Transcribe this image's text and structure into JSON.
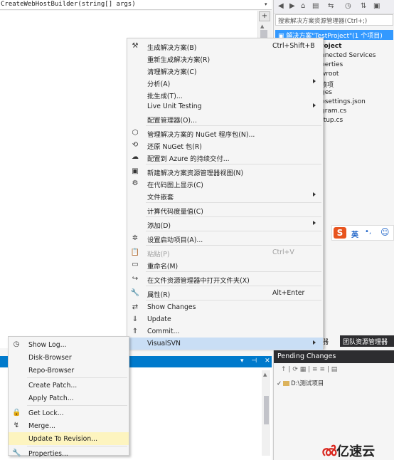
{
  "editor": {
    "signature": "CreateWebHostBuilder(string[] args)"
  },
  "solution_explorer": {
    "search_placeholder": "搜索解决方案资源管理器(Ctrl+;)",
    "solution_label": "解决方案\"TestProject\"(1 个项目)",
    "items": [
      {
        "label": "roject",
        "bold": true
      },
      {
        "label": "nnected Services",
        "bold": false
      },
      {
        "label": "perties",
        "bold": false
      },
      {
        "label": "wroot",
        "bold": false
      },
      {
        "label": "赖项",
        "bold": false
      },
      {
        "label": "ges",
        "bold": false
      },
      {
        "label": "psettings.json",
        "bold": false
      },
      {
        "label": "gram.cs",
        "bold": false
      },
      {
        "label": "rtup.cs",
        "bold": false
      }
    ],
    "tab_partial": "理器",
    "tab_team": "团队资源管理器"
  },
  "context_menu": {
    "items": [
      {
        "icon": "build-icon",
        "glyph": "⚒",
        "label": "生成解决方案(B)",
        "shortcut": "Ctrl+Shift+B"
      },
      {
        "icon": "",
        "glyph": "",
        "label": "重新生成解决方案(R)",
        "shortcut": ""
      },
      {
        "icon": "",
        "glyph": "",
        "label": "清理解决方案(C)",
        "shortcut": ""
      },
      {
        "icon": "",
        "glyph": "",
        "label": "分析(A)",
        "shortcut": "",
        "submenu": true
      },
      {
        "icon": "",
        "glyph": "",
        "label": "批生成(T)...",
        "shortcut": ""
      },
      {
        "icon": "",
        "glyph": "",
        "label": "Live Unit Testing",
        "shortcut": "",
        "submenu": true
      },
      {
        "icon": "",
        "glyph": "",
        "label": "配置管理器(O)...",
        "shortcut": ""
      },
      {
        "sep": true
      },
      {
        "icon": "nuget-manage-icon",
        "glyph": "⬡",
        "label": "管理解决方案的 NuGet 程序包(N)...",
        "shortcut": ""
      },
      {
        "icon": "nuget-restore-icon",
        "glyph": "⟲",
        "label": "还原 NuGet 包(R)",
        "shortcut": ""
      },
      {
        "icon": "azure-icon",
        "glyph": "☁",
        "label": "配置到 Azure 的持续交付...",
        "shortcut": ""
      },
      {
        "sep": true
      },
      {
        "icon": "new-view-icon",
        "glyph": "▣",
        "label": "新建解决方案资源管理器视图(N)",
        "shortcut": ""
      },
      {
        "icon": "code-map-icon",
        "glyph": "⚙",
        "label": "在代码图上显示(C)",
        "shortcut": ""
      },
      {
        "icon": "",
        "glyph": "",
        "label": "文件嵌套",
        "shortcut": "",
        "submenu": true
      },
      {
        "sep": true
      },
      {
        "icon": "",
        "glyph": "",
        "label": "计算代码度量值(C)",
        "shortcut": ""
      },
      {
        "sep": true
      },
      {
        "icon": "",
        "glyph": "",
        "label": "添加(D)",
        "shortcut": "",
        "submenu": true
      },
      {
        "sep": true
      },
      {
        "icon": "settings-icon",
        "glyph": "✲",
        "label": "设置启动项目(A)...",
        "shortcut": ""
      },
      {
        "sep": true
      },
      {
        "icon": "paste-icon",
        "glyph": "📋",
        "label": "粘贴(P)",
        "shortcut": "Ctrl+V",
        "disabled": true
      },
      {
        "icon": "rename-icon",
        "glyph": "▭",
        "label": "重命名(M)",
        "shortcut": ""
      },
      {
        "sep": true
      },
      {
        "icon": "open-folder-icon",
        "glyph": "↪",
        "label": "在文件资源管理器中打开文件夹(X)",
        "shortcut": ""
      },
      {
        "sep": true
      },
      {
        "icon": "wrench-icon",
        "glyph": "🔧",
        "label": "属性(R)",
        "shortcut": "Alt+Enter"
      },
      {
        "sep": true
      },
      {
        "icon": "show-changes-icon",
        "glyph": "⇄",
        "label": "Show Changes",
        "shortcut": ""
      },
      {
        "icon": "update-icon",
        "glyph": "⇓",
        "label": "Update",
        "shortcut": ""
      },
      {
        "icon": "commit-icon",
        "glyph": "⇑",
        "label": "Commit...",
        "shortcut": ""
      },
      {
        "icon": "",
        "glyph": "",
        "label": "VisualSVN",
        "shortcut": "",
        "submenu": true,
        "highlight": true
      }
    ]
  },
  "svn_submenu": {
    "items": [
      {
        "icon": "clock-icon",
        "glyph": "◷",
        "label": "Show Log..."
      },
      {
        "icon": "",
        "glyph": "",
        "label": "Disk-Browser"
      },
      {
        "icon": "",
        "glyph": "",
        "label": "Repo-Browser"
      },
      {
        "sep": true
      },
      {
        "icon": "",
        "glyph": "",
        "label": "Create Patch..."
      },
      {
        "icon": "",
        "glyph": "",
        "label": "Apply Patch..."
      },
      {
        "sep": true
      },
      {
        "icon": "lock-icon",
        "glyph": "🔒",
        "label": "Get Lock..."
      },
      {
        "icon": "merge-icon",
        "glyph": "↯",
        "label": "Merge..."
      },
      {
        "icon": "",
        "glyph": "",
        "label": "Update To Revision...",
        "selected": true
      },
      {
        "sep": true
      },
      {
        "icon": "wrench-icon",
        "glyph": "🔧",
        "label": "Properties..."
      }
    ]
  },
  "pending_changes": {
    "title": "Pending Changes",
    "folder": "D:\\测试项目"
  },
  "ime": {
    "mode": "英",
    "punct": "•,"
  },
  "watermark": "亿速云"
}
